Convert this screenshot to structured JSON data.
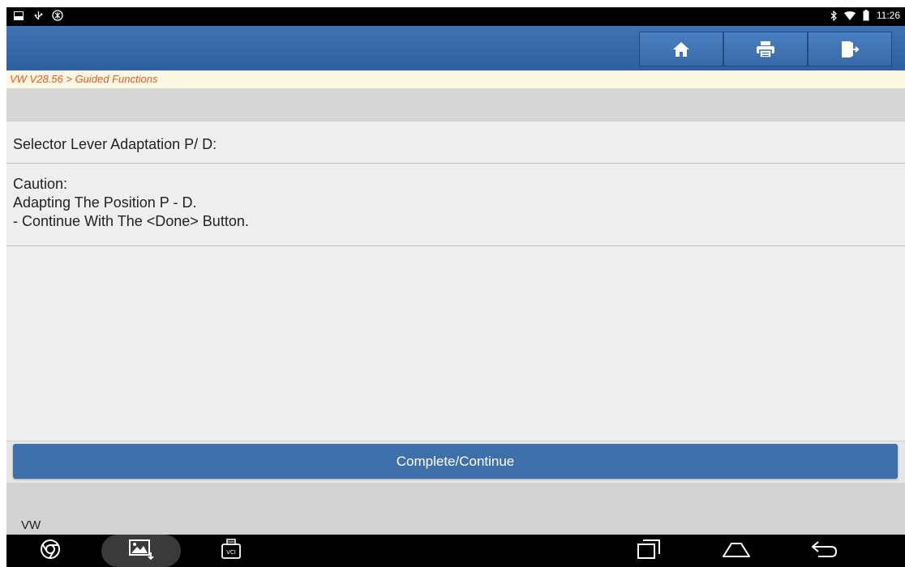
{
  "status_bar": {
    "time": "11:26",
    "left_icons": [
      "screenshot-icon",
      "usb-icon",
      "vci-icon"
    ],
    "right_icons": [
      "bluetooth-icon",
      "wifi-icon",
      "battery-icon"
    ]
  },
  "toolbar": {
    "buttons": [
      "home-icon",
      "print-icon",
      "exit-icon"
    ]
  },
  "breadcrumb": "VW V28.56 > Guided Functions",
  "function_title": "Selector Lever Adaptation P/ D:",
  "message_lines": [
    "Caution:",
    "Adapting The Position P - D.",
    "- Continue With The <Done> Button."
  ],
  "action_button": "Complete/Continue",
  "footer_label": "VW",
  "nav_bar": {
    "left": [
      "browser-icon",
      "gallery-icon",
      "vci-icon"
    ],
    "right": [
      "recents-icon",
      "home-icon",
      "back-icon"
    ]
  }
}
